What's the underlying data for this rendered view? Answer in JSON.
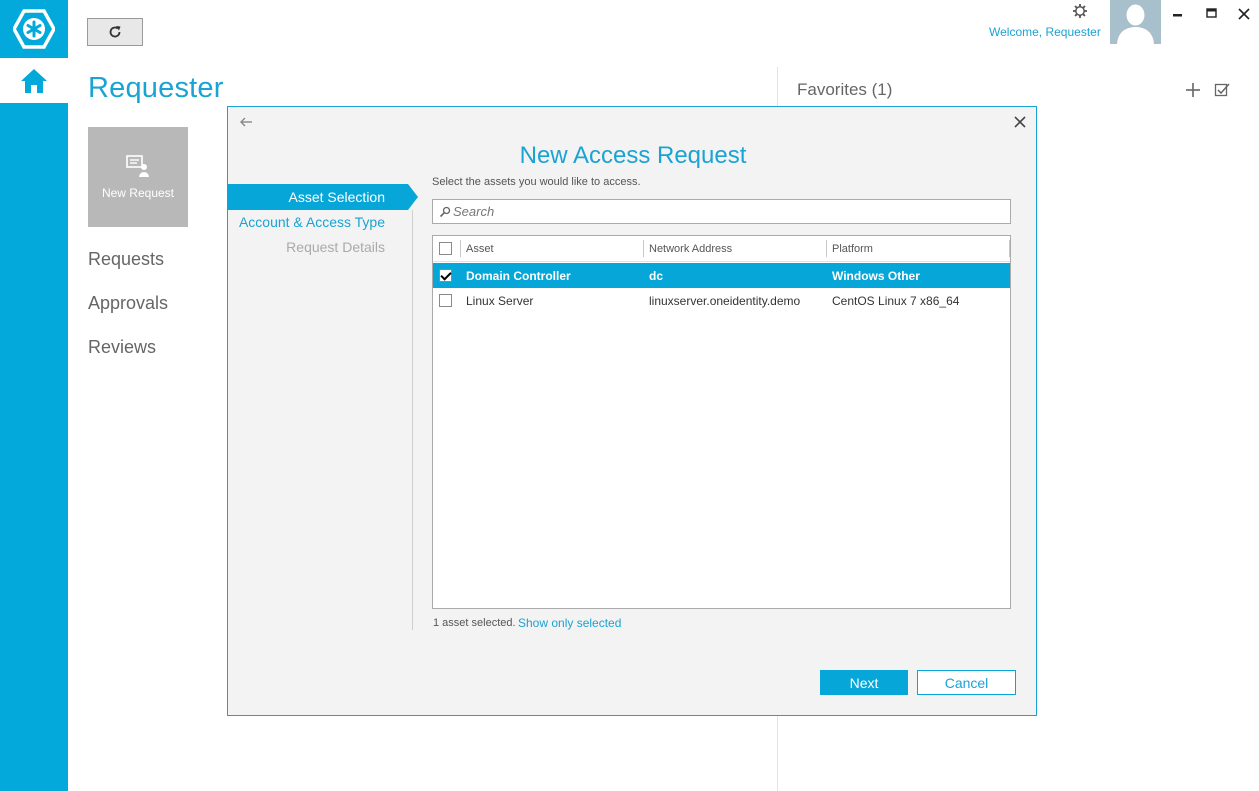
{
  "app": {
    "page_title": "Requester",
    "welcome_text": "Welcome, Requester",
    "accent_color": "#06a6d8"
  },
  "toolbar": {
    "refresh_icon": "refresh-icon"
  },
  "tiles": [
    {
      "label": "New Request",
      "icon": "new-request-icon"
    }
  ],
  "side_nav": [
    {
      "label": "Requests"
    },
    {
      "label": "Approvals"
    },
    {
      "label": "Reviews"
    }
  ],
  "favorites": {
    "title": "Favorites (1)"
  },
  "dialog": {
    "title": "New Access Request",
    "steps": [
      {
        "label": "Asset Selection",
        "state": "active"
      },
      {
        "label": "Account & Access Type",
        "state": "enabled"
      },
      {
        "label": "Request Details",
        "state": "disabled"
      }
    ],
    "instruction": "Select the assets you would like to access.",
    "search": {
      "placeholder": "Search",
      "value": ""
    },
    "table": {
      "columns": [
        "Asset",
        "Network Address",
        "Platform"
      ],
      "rows": [
        {
          "asset": "Domain Controller",
          "address": "dc",
          "platform": "Windows Other",
          "checked": true,
          "selected": true
        },
        {
          "asset": "Linux Server",
          "address": "linuxserver.oneidentity.demo",
          "platform": "CentOS Linux 7 x86_64",
          "checked": false,
          "selected": false
        }
      ]
    },
    "selected_count": "1 asset selected.",
    "show_only_selected": "Show only selected",
    "next_label": "Next",
    "cancel_label": "Cancel"
  }
}
